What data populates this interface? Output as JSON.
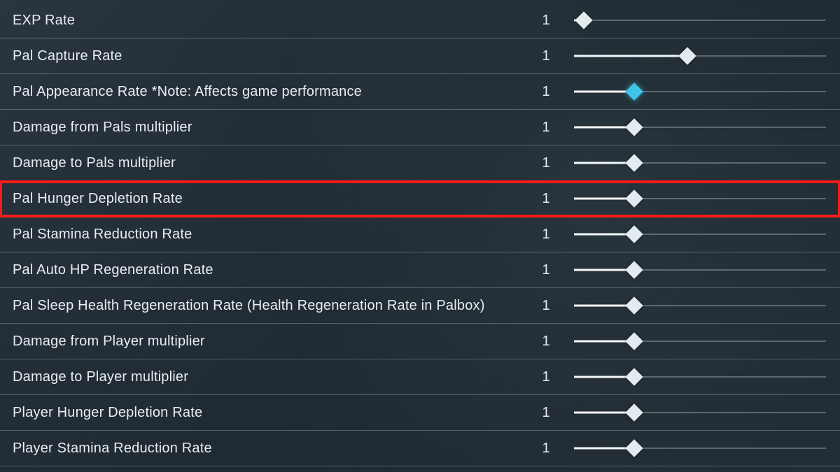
{
  "colors": {
    "accent": "#3fc4e8",
    "highlight": "#ff1a1a"
  },
  "settings": [
    {
      "label": "EXP Rate",
      "value": "1",
      "fill_pct": 4,
      "accent": false,
      "highlighted": false
    },
    {
      "label": "Pal Capture Rate",
      "value": "1",
      "fill_pct": 45,
      "accent": false,
      "highlighted": false
    },
    {
      "label": "Pal Appearance Rate *Note: Affects game performance",
      "value": "1",
      "fill_pct": 24,
      "accent": true,
      "highlighted": false
    },
    {
      "label": "Damage from Pals multiplier",
      "value": "1",
      "fill_pct": 24,
      "accent": false,
      "highlighted": false
    },
    {
      "label": "Damage to Pals multiplier",
      "value": "1",
      "fill_pct": 24,
      "accent": false,
      "highlighted": false
    },
    {
      "label": "Pal Hunger Depletion Rate",
      "value": "1",
      "fill_pct": 24,
      "accent": false,
      "highlighted": true
    },
    {
      "label": "Pal Stamina Reduction Rate",
      "value": "1",
      "fill_pct": 24,
      "accent": false,
      "highlighted": false
    },
    {
      "label": "Pal Auto HP Regeneration Rate",
      "value": "1",
      "fill_pct": 24,
      "accent": false,
      "highlighted": false
    },
    {
      "label": "Pal Sleep Health Regeneration Rate (Health Regeneration Rate in Palbox)",
      "value": "1",
      "fill_pct": 24,
      "accent": false,
      "highlighted": false
    },
    {
      "label": "Damage from Player multiplier",
      "value": "1",
      "fill_pct": 24,
      "accent": false,
      "highlighted": false
    },
    {
      "label": "Damage to Player multiplier",
      "value": "1",
      "fill_pct": 24,
      "accent": false,
      "highlighted": false
    },
    {
      "label": "Player Hunger Depletion Rate",
      "value": "1",
      "fill_pct": 24,
      "accent": false,
      "highlighted": false
    },
    {
      "label": "Player Stamina Reduction Rate",
      "value": "1",
      "fill_pct": 24,
      "accent": false,
      "highlighted": false
    }
  ]
}
